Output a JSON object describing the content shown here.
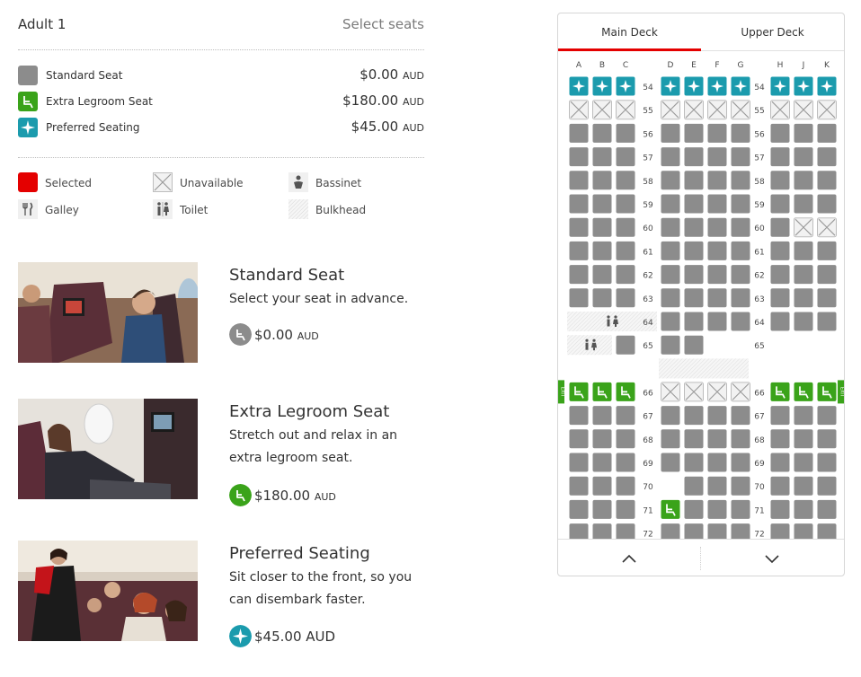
{
  "header": {
    "passenger": "Adult 1",
    "action": "Select seats"
  },
  "fares": [
    {
      "label": "Standard Seat",
      "price": "$0.00",
      "currency": "AUD",
      "icon": "standard-seat-icon"
    },
    {
      "label": "Extra Legroom Seat",
      "price": "$180.00",
      "currency": "AUD",
      "icon": "extra-legroom-icon"
    },
    {
      "label": "Preferred Seating",
      "price": "$45.00",
      "currency": "AUD",
      "icon": "preferred-star-icon"
    }
  ],
  "legend": [
    {
      "label": "Selected",
      "icon": "selected-swatch-icon"
    },
    {
      "label": "Unavailable",
      "icon": "unavailable-cross-icon"
    },
    {
      "label": "Bassinet",
      "icon": "bassinet-icon"
    },
    {
      "label": "Galley",
      "icon": "galley-cutlery-icon"
    },
    {
      "label": "Toilet",
      "icon": "toilet-icon"
    },
    {
      "label": "Bulkhead",
      "icon": "bulkhead-hatch-icon"
    }
  ],
  "cards": [
    {
      "title": "Standard Seat",
      "description": "Select your seat in advance.",
      "price": "$0.00",
      "currency": "AUD"
    },
    {
      "title": "Extra Legroom Seat",
      "description": "Stretch out and relax in an extra legroom seat.",
      "price": "$180.00",
      "currency": "AUD"
    },
    {
      "title": "Preferred Seating",
      "description": "Sit closer to the front, so you can disembark faster.",
      "price": "$45.00 AUD",
      "currency": ""
    }
  ],
  "seatmap": {
    "tabs": [
      "Main Deck",
      "Upper Deck"
    ],
    "active_tab": "Main Deck",
    "columns": [
      "A",
      "B",
      "C",
      "D",
      "E",
      "F",
      "G",
      "H",
      "J",
      "K"
    ],
    "exit_label": "EXIT",
    "rows": [
      {
        "row": "54",
        "seats": "PPPPPPPPPP"
      },
      {
        "row": "55",
        "seats": "UUUUUUUUUU"
      },
      {
        "row": "56",
        "seats": "SSSSSSSSSS"
      },
      {
        "row": "57",
        "seats": "SSSSSSSSSS"
      },
      {
        "row": "58",
        "seats": "SSSSSSSSSS"
      },
      {
        "row": "59",
        "seats": "SSSSSSSSSS"
      },
      {
        "row": "60",
        "seats": "SSSSSSSSUU"
      },
      {
        "row": "61",
        "seats": "SSSSSSSSSS"
      },
      {
        "row": "62",
        "seats": "SSSSSSSSSS"
      },
      {
        "row": "63",
        "seats": "SSSSSSSSSS"
      },
      {
        "row": "64",
        "seats": "---SSSSSSS"
      },
      {
        "row": "65",
        "seats": "--SSS-----"
      },
      {
        "row": "66",
        "seats": "LLLUUUULLL"
      },
      {
        "row": "67",
        "seats": "SSSSSSSSSS"
      },
      {
        "row": "68",
        "seats": "SSSSSSSSSS"
      },
      {
        "row": "69",
        "seats": "SSSSSSSSSS"
      },
      {
        "row": "70",
        "seats": "SSS-SSSSSS"
      },
      {
        "row": "71",
        "seats": "SSSLSSSSSS"
      },
      {
        "row": "72",
        "seats": "SSSSSSSSSS"
      }
    ],
    "colors": {
      "standard": "#8c8c8c",
      "legroom": "#3aa31a",
      "preferred": "#1b9bad",
      "selected": "#e40000",
      "unavailable_bg": "#f2f2f2",
      "unavailable_line": "#9a9a9a",
      "bulkhead": "#f0f0f0",
      "label": "#4a4a4a"
    },
    "scroll_up": "chevron-up-icon",
    "scroll_down": "chevron-down-icon"
  }
}
